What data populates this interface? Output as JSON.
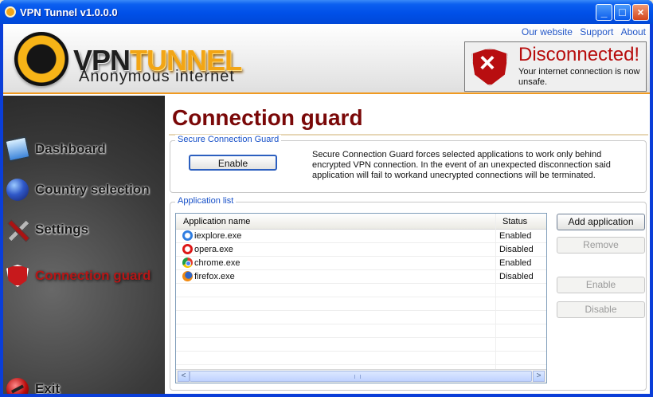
{
  "window": {
    "title": "VPN Tunnel v1.0.0.0",
    "minimize": "_",
    "maximize": "□",
    "close": "×"
  },
  "header": {
    "logo_vpn": "VPN",
    "logo_tunnel": "TUNNEL",
    "tagline": "Anonymous internet",
    "links": [
      "Our website",
      "Support",
      "About"
    ],
    "status": {
      "title": "Disconnected!",
      "message": "Your internet connection is now unsafe.",
      "icon": "x-shield-icon",
      "color": "#b70d0d"
    }
  },
  "sidebar": {
    "items": [
      {
        "label": "Dashboard",
        "icon": "monitor-icon",
        "active": false
      },
      {
        "label": "Country selection",
        "icon": "globe-icon",
        "active": false
      },
      {
        "label": "Settings",
        "icon": "tools-icon",
        "active": false
      },
      {
        "label": "Connection guard",
        "icon": "shield-icon",
        "active": true
      },
      {
        "label": "Exit",
        "icon": "exit-icon",
        "active": false
      }
    ]
  },
  "main": {
    "title": "Connection guard",
    "secure_group": {
      "title": "Secure Connection Guard",
      "button": "Enable",
      "description": "Secure Connection Guard forces selected applications to work only behind encrypted VPN connection. In the event of an unexpected disconnection said application will fail to workand unecrypted connections will be terminated."
    },
    "app_group": {
      "title": "Application list",
      "columns": [
        "Application name",
        "Status"
      ],
      "rows": [
        {
          "name": "iexplore.exe",
          "status": "Enabled",
          "icon": "internet-explorer-icon"
        },
        {
          "name": "opera.exe",
          "status": "Disabled",
          "icon": "opera-icon"
        },
        {
          "name": "chrome.exe",
          "status": "Enabled",
          "icon": "chrome-icon"
        },
        {
          "name": "firefox.exe",
          "status": "Disabled",
          "icon": "firefox-icon"
        }
      ],
      "buttons": {
        "add": "Add application",
        "remove": "Remove",
        "enable": "Enable",
        "disable": "Disable"
      },
      "scroll_left": "<",
      "scroll_right": ">",
      "grip": "III"
    }
  }
}
